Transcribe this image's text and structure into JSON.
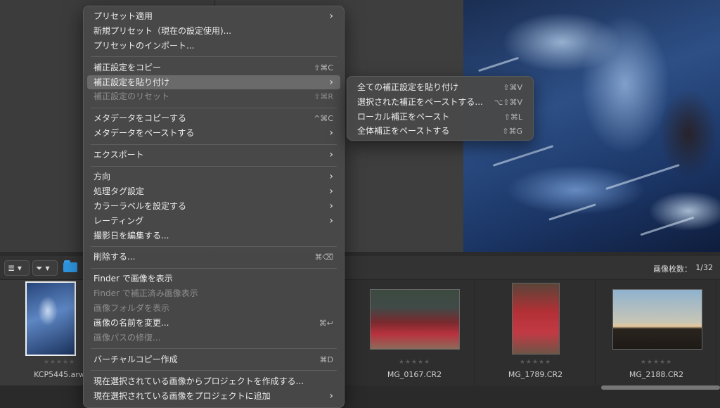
{
  "toolbar": {
    "sort_icon": "sort-lines-icon",
    "filter_icon": "funnel-icon",
    "dropdown_arrow": "▾",
    "folder_icon": "folder-icon",
    "count_label": "画像枚数：",
    "count_value": "1/32"
  },
  "filmstrip": {
    "stars": "★★★★★",
    "items": [
      {
        "filename": "KCP5445.arw",
        "selected": true
      },
      {
        "filename": "MG_0167.CR2",
        "selected": false
      },
      {
        "filename": "MG_1789.CR2",
        "selected": false
      },
      {
        "filename": "MG_2188.CR2",
        "selected": false
      }
    ]
  },
  "context_menu": {
    "groups": [
      [
        {
          "label": "プリセット適用",
          "submenu": true
        },
        {
          "label": "新規プリセット（現在の設定使用)..."
        },
        {
          "label": "プリセットのインポート..."
        }
      ],
      [
        {
          "label": "補正設定をコピー",
          "shortcut": "⇧⌘C"
        },
        {
          "label": "補正設定を貼り付け",
          "submenu": true,
          "highlighted": true
        },
        {
          "label": "補正設定のリセット",
          "shortcut": "⇧⌘R",
          "disabled": true
        }
      ],
      [
        {
          "label": "メタデータをコピーする",
          "shortcut": "^⌘C"
        },
        {
          "label": "メタデータをペーストする",
          "submenu": true
        }
      ],
      [
        {
          "label": "エクスポート",
          "submenu": true
        }
      ],
      [
        {
          "label": "方向",
          "submenu": true
        },
        {
          "label": "処理タグ設定",
          "submenu": true
        },
        {
          "label": "カラーラベルを設定する",
          "submenu": true
        },
        {
          "label": "レーティング",
          "submenu": true
        },
        {
          "label": "撮影日を編集する..."
        }
      ],
      [
        {
          "label": "削除する...",
          "shortcut": "⌘⌫"
        }
      ],
      [
        {
          "label": "Finder で画像を表示"
        },
        {
          "label": "Finder で補正済み画像表示",
          "disabled": true
        },
        {
          "label": "画像フォルダを表示",
          "disabled": true
        },
        {
          "label": "画像の名前を変更...",
          "shortcut": "⌘↩"
        },
        {
          "label": "画像パスの修復...",
          "disabled": true
        }
      ],
      [
        {
          "label": "バーチャルコピー作成",
          "shortcut": "⌘D"
        }
      ],
      [
        {
          "label": "現在選択されている画像からプロジェクトを作成する..."
        },
        {
          "label": "現在選択されている画像をプロジェクトに追加",
          "submenu": true
        }
      ]
    ]
  },
  "submenu": {
    "items": [
      {
        "label": "全ての補正設定を貼り付け",
        "shortcut": "⇧⌘V"
      },
      {
        "label": "選択された補正をペーストする...",
        "shortcut": "⌥⇧⌘V"
      },
      {
        "label": "ローカル補正をペースト",
        "shortcut": "⇧⌘L"
      },
      {
        "label": "全体補正をペーストする",
        "shortcut": "⇧⌘G"
      }
    ]
  },
  "submenu_arrow": "›"
}
